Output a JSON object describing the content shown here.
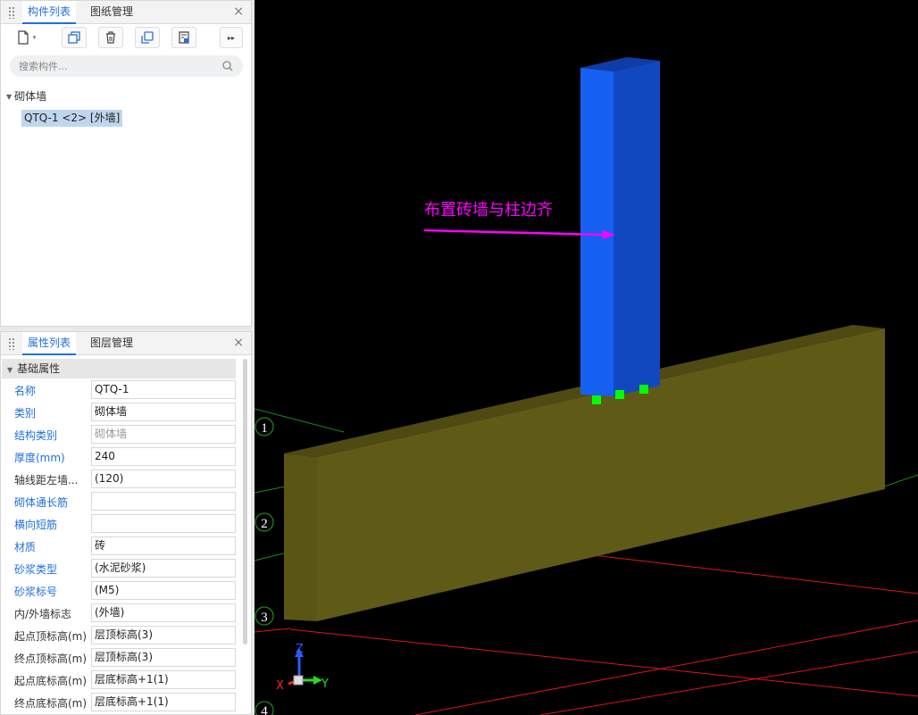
{
  "top_panel": {
    "tabs": [
      "构件列表",
      "图纸管理"
    ],
    "close_glyph": "×",
    "toolbar_icons": [
      "new-component-icon",
      "dropdown-icon",
      "copy-icon",
      "delete-icon",
      "layer-copy-icon",
      "extract-icon",
      "more-icon"
    ],
    "search_placeholder": "搜索构件...",
    "tree": {
      "group": "砌体墙",
      "item": "QTQ-1 <2> [外墙]"
    }
  },
  "bottom_panel": {
    "tabs": [
      "属性列表",
      "图层管理"
    ],
    "close_glyph": "×",
    "section": "基础属性",
    "properties": [
      {
        "label": "名称",
        "value": "QTQ-1",
        "label_color": "blue"
      },
      {
        "label": "类别",
        "value": "砌体墙",
        "label_color": "blue"
      },
      {
        "label": "结构类别",
        "value": "砌体墙",
        "label_color": "blue",
        "value_grey": true
      },
      {
        "label": "厚度(mm)",
        "value": "240",
        "label_color": "blue"
      },
      {
        "label": "轴线距左墙...",
        "value": "(120)",
        "label_color": "dark"
      },
      {
        "label": "砌体通长筋",
        "value": "",
        "label_color": "blue"
      },
      {
        "label": "横向短筋",
        "value": "",
        "label_color": "blue"
      },
      {
        "label": "材质",
        "value": "砖",
        "label_color": "blue"
      },
      {
        "label": "砂浆类型",
        "value": "(水泥砂浆)",
        "label_color": "blue"
      },
      {
        "label": "砂浆标号",
        "value": "(M5)",
        "label_color": "blue"
      },
      {
        "label": "内/外墙标志",
        "value": "(外墙)",
        "label_color": "dark"
      },
      {
        "label": "起点顶标高(m)",
        "value": "层顶标高(3)",
        "label_color": "dark"
      },
      {
        "label": "终点顶标高(m)",
        "value": "层顶标高(3)",
        "label_color": "dark"
      },
      {
        "label": "起点底标高(m)",
        "value": "层底标高+1(1)",
        "label_color": "dark"
      },
      {
        "label": "终点底标高(m)",
        "value": "层底标高+1(1)",
        "label_color": "dark"
      }
    ]
  },
  "viewport": {
    "annotation": "布置砖墙与柱边齐",
    "axis_labels": [
      "1",
      "2",
      "3",
      "4"
    ],
    "gizmo": {
      "x": "X",
      "y": "Y",
      "z": "Z"
    },
    "colors": {
      "background": "#000000",
      "wall_front": "#5f5a16",
      "wall_top": "#4e4a12",
      "column_front": "#1560f0",
      "column_side": "#1148c0",
      "column_top": "#0f3da8",
      "annotation": "#ff00ff",
      "grip": "#00ff00",
      "grid_green": "#1f8a1f",
      "grid_red": "#e01414"
    }
  }
}
